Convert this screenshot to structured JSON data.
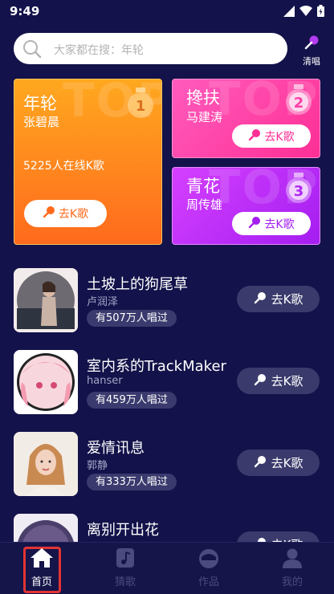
{
  "status_bar": {
    "time": "9:49"
  },
  "search": {
    "placeholder": "大家都在搜：年轮"
  },
  "acapella": {
    "label": "清唱"
  },
  "top_cards": [
    {
      "song": "年轮",
      "singer": "张碧晨",
      "online": "5225人在线K歌",
      "button": "去K歌",
      "rank": "1",
      "bg_text": "TOP"
    },
    {
      "song": "搀扶",
      "singer": "马建涛",
      "button": "去K歌",
      "rank": "2",
      "bg_text": "TOP"
    },
    {
      "song": "青花",
      "singer": "周传雄",
      "button": "去K歌",
      "rank": "3",
      "bg_text": "TOP"
    }
  ],
  "songs": [
    {
      "title": "土坡上的狗尾草",
      "artist": "卢润泽",
      "count": "有507万人唱过",
      "button": "去K歌"
    },
    {
      "title": "室内系的TrackMaker",
      "artist": "hanser",
      "count": "有459万人唱过",
      "button": "去K歌"
    },
    {
      "title": "爱情讯息",
      "artist": "郭静",
      "count": "有333万人唱过",
      "button": "去K歌"
    },
    {
      "title": "离别开出花",
      "artist": "",
      "count": "",
      "button": "去K歌"
    }
  ],
  "nav": [
    {
      "label": "首页",
      "icon": "home-icon",
      "active": true
    },
    {
      "label": "猜歌",
      "icon": "music-note-icon",
      "active": false
    },
    {
      "label": "作品",
      "icon": "works-icon",
      "active": false
    },
    {
      "label": "我的",
      "icon": "profile-icon",
      "active": false
    }
  ],
  "colors": {
    "background": "#13124a",
    "card1": "#ff8a1f",
    "card2": "#ff3fa6",
    "card3": "#c030f8",
    "active_nav": "#ffffff",
    "inactive_nav": "#4b4b80",
    "highlight_box": "#e33434"
  }
}
